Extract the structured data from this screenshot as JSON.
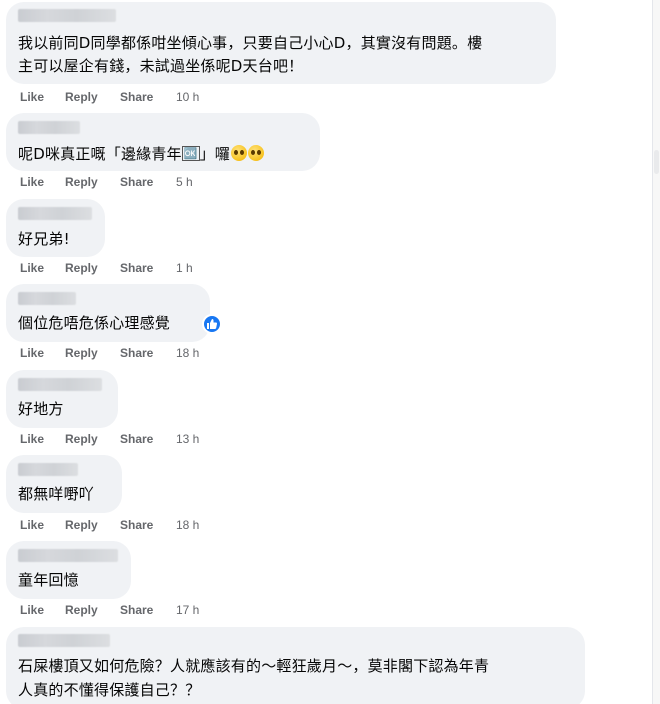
{
  "comments": [
    {
      "lines": [
        "我以前同D同學都係咁坐傾心事，只要自己小心D，其實沒有問題。樓",
        "主可以屋企有錢，未試過坐係呢D天台吧！"
      ],
      "like": "Like",
      "reply": "Reply",
      "share": "Share",
      "time": "10 h"
    },
    {
      "text_before": "呢D咪真正嘅「邊緣青年",
      "text_mid": "🆗",
      "text_after": "」囉",
      "like": "Like",
      "reply": "Reply",
      "share": "Share",
      "time": "5 h"
    },
    {
      "text": "好兄弟!",
      "like": "Like",
      "reply": "Reply",
      "share": "Share",
      "time": "1 h"
    },
    {
      "text": "個位危唔危係心理感覺",
      "like": "Like",
      "reply": "Reply",
      "share": "Share",
      "time": "18 h",
      "reaction": "like-reaction"
    },
    {
      "text": "好地方",
      "like": "Like",
      "reply": "Reply",
      "share": "Share",
      "time": "13 h"
    },
    {
      "text": "都無咩嘢吖",
      "like": "Like",
      "reply": "Reply",
      "share": "Share",
      "time": "18 h"
    },
    {
      "text": "童年回憶",
      "like": "Like",
      "reply": "Reply",
      "share": "Share",
      "time": "17 h"
    },
    {
      "lines": [
        "石屎樓頂又如何危險？人就應該有的～輕狂歲月～，莫非閣下認為年青",
        "人真的不懂得保護自己？？"
      ]
    }
  ],
  "colors": {
    "bubble": "#f0f2f5",
    "action_text": "#65676b",
    "like_badge": "#1877f2"
  }
}
